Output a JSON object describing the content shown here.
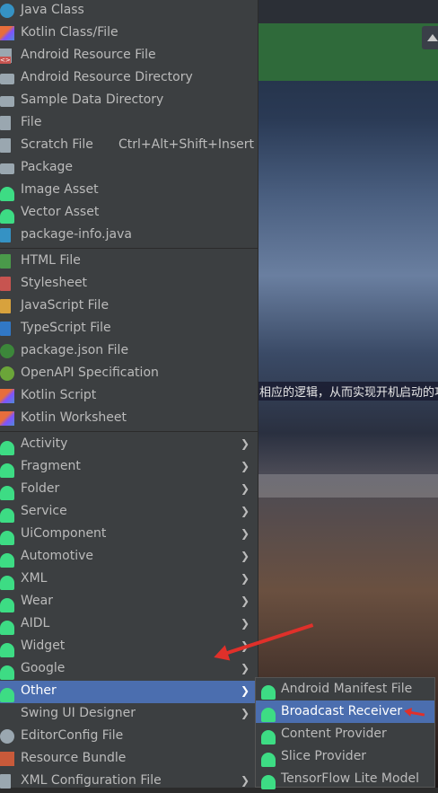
{
  "background": {
    "text_snippet": "相应的逻辑，从而实现开机启动的功"
  },
  "menu": {
    "group1": [
      {
        "label": "Java Class",
        "icon": "java-class-icon"
      },
      {
        "label": "Kotlin Class/File",
        "icon": "kotlin-icon"
      },
      {
        "label": "Android Resource File",
        "icon": "resource-file-icon"
      },
      {
        "label": "Android Resource Directory",
        "icon": "folder-icon"
      },
      {
        "label": "Sample Data Directory",
        "icon": "folder-icon"
      },
      {
        "label": "File",
        "icon": "file-icon"
      },
      {
        "label": "Scratch File",
        "icon": "scratch-file-icon",
        "shortcut": "Ctrl+Alt+Shift+Insert"
      },
      {
        "label": "Package",
        "icon": "package-icon"
      },
      {
        "label": "Image Asset",
        "icon": "android-icon"
      },
      {
        "label": "Vector Asset",
        "icon": "android-icon"
      },
      {
        "label": "package-info.java",
        "icon": "java-file-icon"
      }
    ],
    "group2": [
      {
        "label": "HTML File",
        "icon": "html-icon"
      },
      {
        "label": "Stylesheet",
        "icon": "css-icon"
      },
      {
        "label": "JavaScript File",
        "icon": "js-icon"
      },
      {
        "label": "TypeScript File",
        "icon": "ts-icon"
      },
      {
        "label": "package.json File",
        "icon": "nodejs-icon"
      },
      {
        "label": "OpenAPI Specification",
        "icon": "openapi-icon"
      },
      {
        "label": "Kotlin Script",
        "icon": "kotlin-icon"
      },
      {
        "label": "Kotlin Worksheet",
        "icon": "kotlin-icon"
      }
    ],
    "group3": [
      {
        "label": "Activity"
      },
      {
        "label": "Fragment"
      },
      {
        "label": "Folder"
      },
      {
        "label": "Service"
      },
      {
        "label": "UiComponent"
      },
      {
        "label": "Automotive"
      },
      {
        "label": "XML"
      },
      {
        "label": "Wear"
      },
      {
        "label": "AIDL"
      },
      {
        "label": "Widget"
      },
      {
        "label": "Google"
      },
      {
        "label": "Other"
      },
      {
        "label": "Swing UI Designer"
      },
      {
        "label": "EditorConfig File"
      },
      {
        "label": "Resource Bundle"
      },
      {
        "label": "XML Configuration File"
      }
    ]
  },
  "submenu": {
    "items": [
      {
        "label": "Android Manifest File"
      },
      {
        "label": "Broadcast Receiver"
      },
      {
        "label": "Content Provider"
      },
      {
        "label": "Slice Provider"
      },
      {
        "label": "TensorFlow Lite Model"
      }
    ]
  },
  "colors": {
    "menu_bg": "#3c3f41",
    "selection": "#4b6eaf",
    "android_green": "#3ddc84",
    "annotation_red": "#e0302a"
  }
}
